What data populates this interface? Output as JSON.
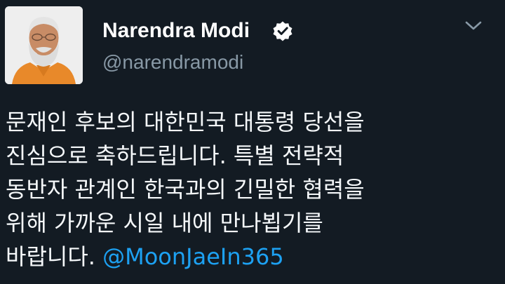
{
  "tweet": {
    "author": {
      "display_name": "Narendra Modi",
      "handle": "@narendramodi",
      "verified": true,
      "avatar_icon": "profile-photo"
    },
    "menu_icon": "chevron-down-icon",
    "text_lines": [
      "문재인 후보의 대한민국 대통령 당선을",
      "진심으로 축하드립니다. 특별 전략적",
      "동반자 관계인 한국과의 긴밀한 협력을",
      "위해 가까운 시일 내에 만나뵙기를",
      "바랍니다."
    ],
    "mention": "@MoonJaeIn365"
  },
  "colors": {
    "background": "#131b23",
    "text": "#f5f8fa",
    "handle": "#8899a6",
    "link": "#1da1f2",
    "verified_badge": "#ffffff"
  }
}
